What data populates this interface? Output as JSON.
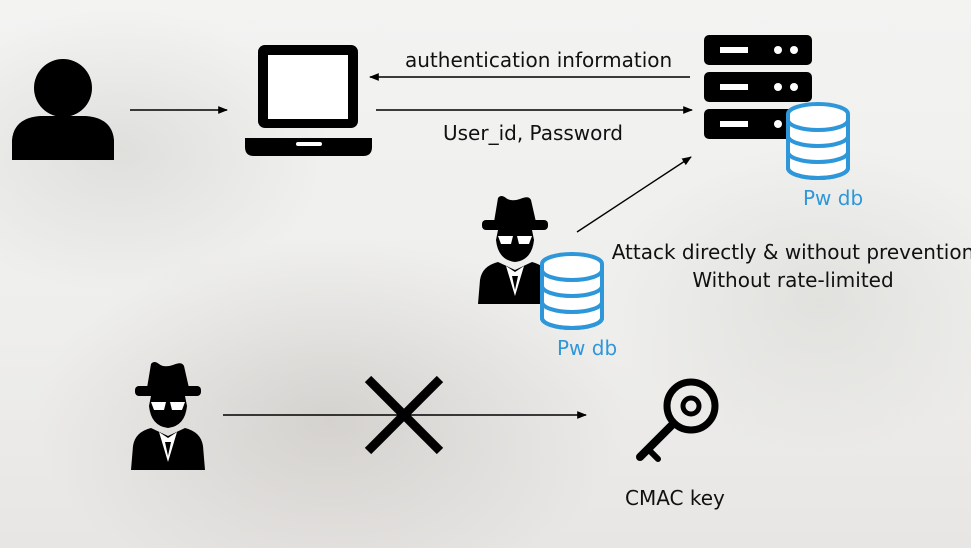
{
  "labels": {
    "auth_info": "authentication information",
    "credentials": "User_id, Password",
    "server_db": "Pw db",
    "attacker_db": "Pw db",
    "attack_line1": "Attack directly & without prevention",
    "attack_line2": "Without rate-limited",
    "cmac_key": "CMAC key"
  },
  "icons": {
    "user": "user-icon",
    "laptop": "laptop-icon",
    "server": "server-icon",
    "database": "database-icon",
    "hacker": "hacker-icon",
    "blocked": "x-mark-icon",
    "key": "key-icon"
  },
  "colors": {
    "icon": "#000000",
    "database": "#2e97d9",
    "text": "#111111",
    "db_label": "#2e97d9"
  }
}
